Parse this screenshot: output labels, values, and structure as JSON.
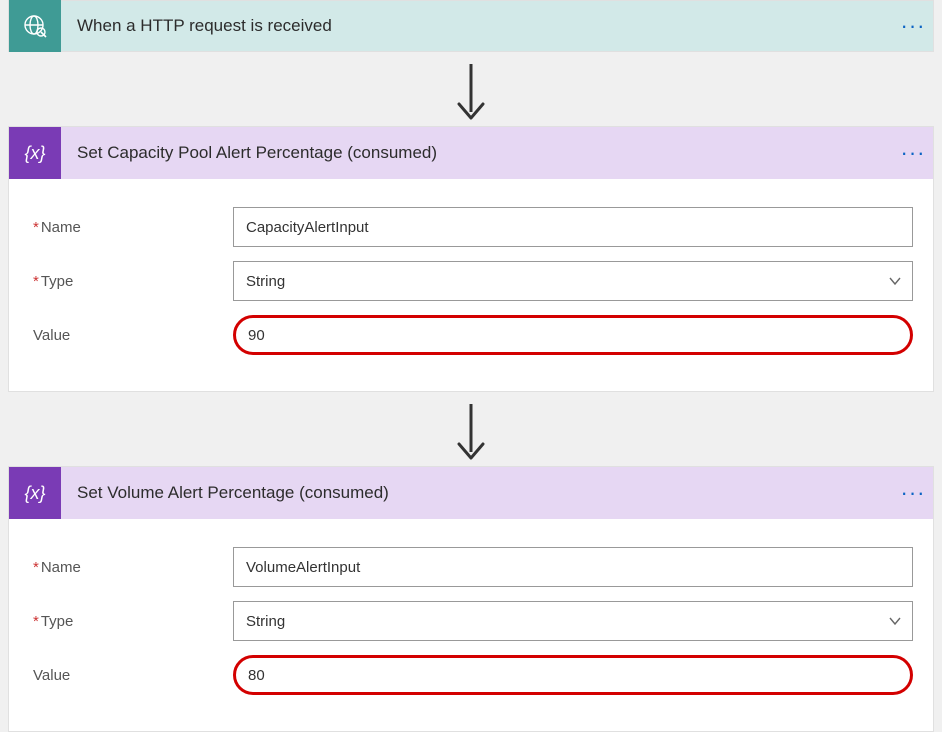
{
  "trigger": {
    "title": "When a HTTP request is received",
    "iconName": "globe-icon",
    "more": "···"
  },
  "actions": [
    {
      "id": "capacity",
      "title": "Set Capacity Pool Alert Percentage (consumed)",
      "iconText": "{x}",
      "more": "···",
      "fields": {
        "nameLabel": "Name",
        "nameValue": "CapacityAlertInput",
        "typeLabel": "Type",
        "typeValue": "String",
        "valueLabel": "Value",
        "valueValue": "90",
        "nameRequired": true,
        "typeRequired": true,
        "valueRequired": false,
        "valueHighlighted": true
      }
    },
    {
      "id": "volume",
      "title": "Set Volume Alert Percentage (consumed)",
      "iconText": "{x}",
      "more": "···",
      "fields": {
        "nameLabel": "Name",
        "nameValue": "VolumeAlertInput",
        "typeLabel": "Type",
        "typeValue": "String",
        "valueLabel": "Value",
        "valueValue": "80",
        "nameRequired": true,
        "typeRequired": true,
        "valueRequired": false,
        "valueHighlighted": true
      }
    }
  ]
}
